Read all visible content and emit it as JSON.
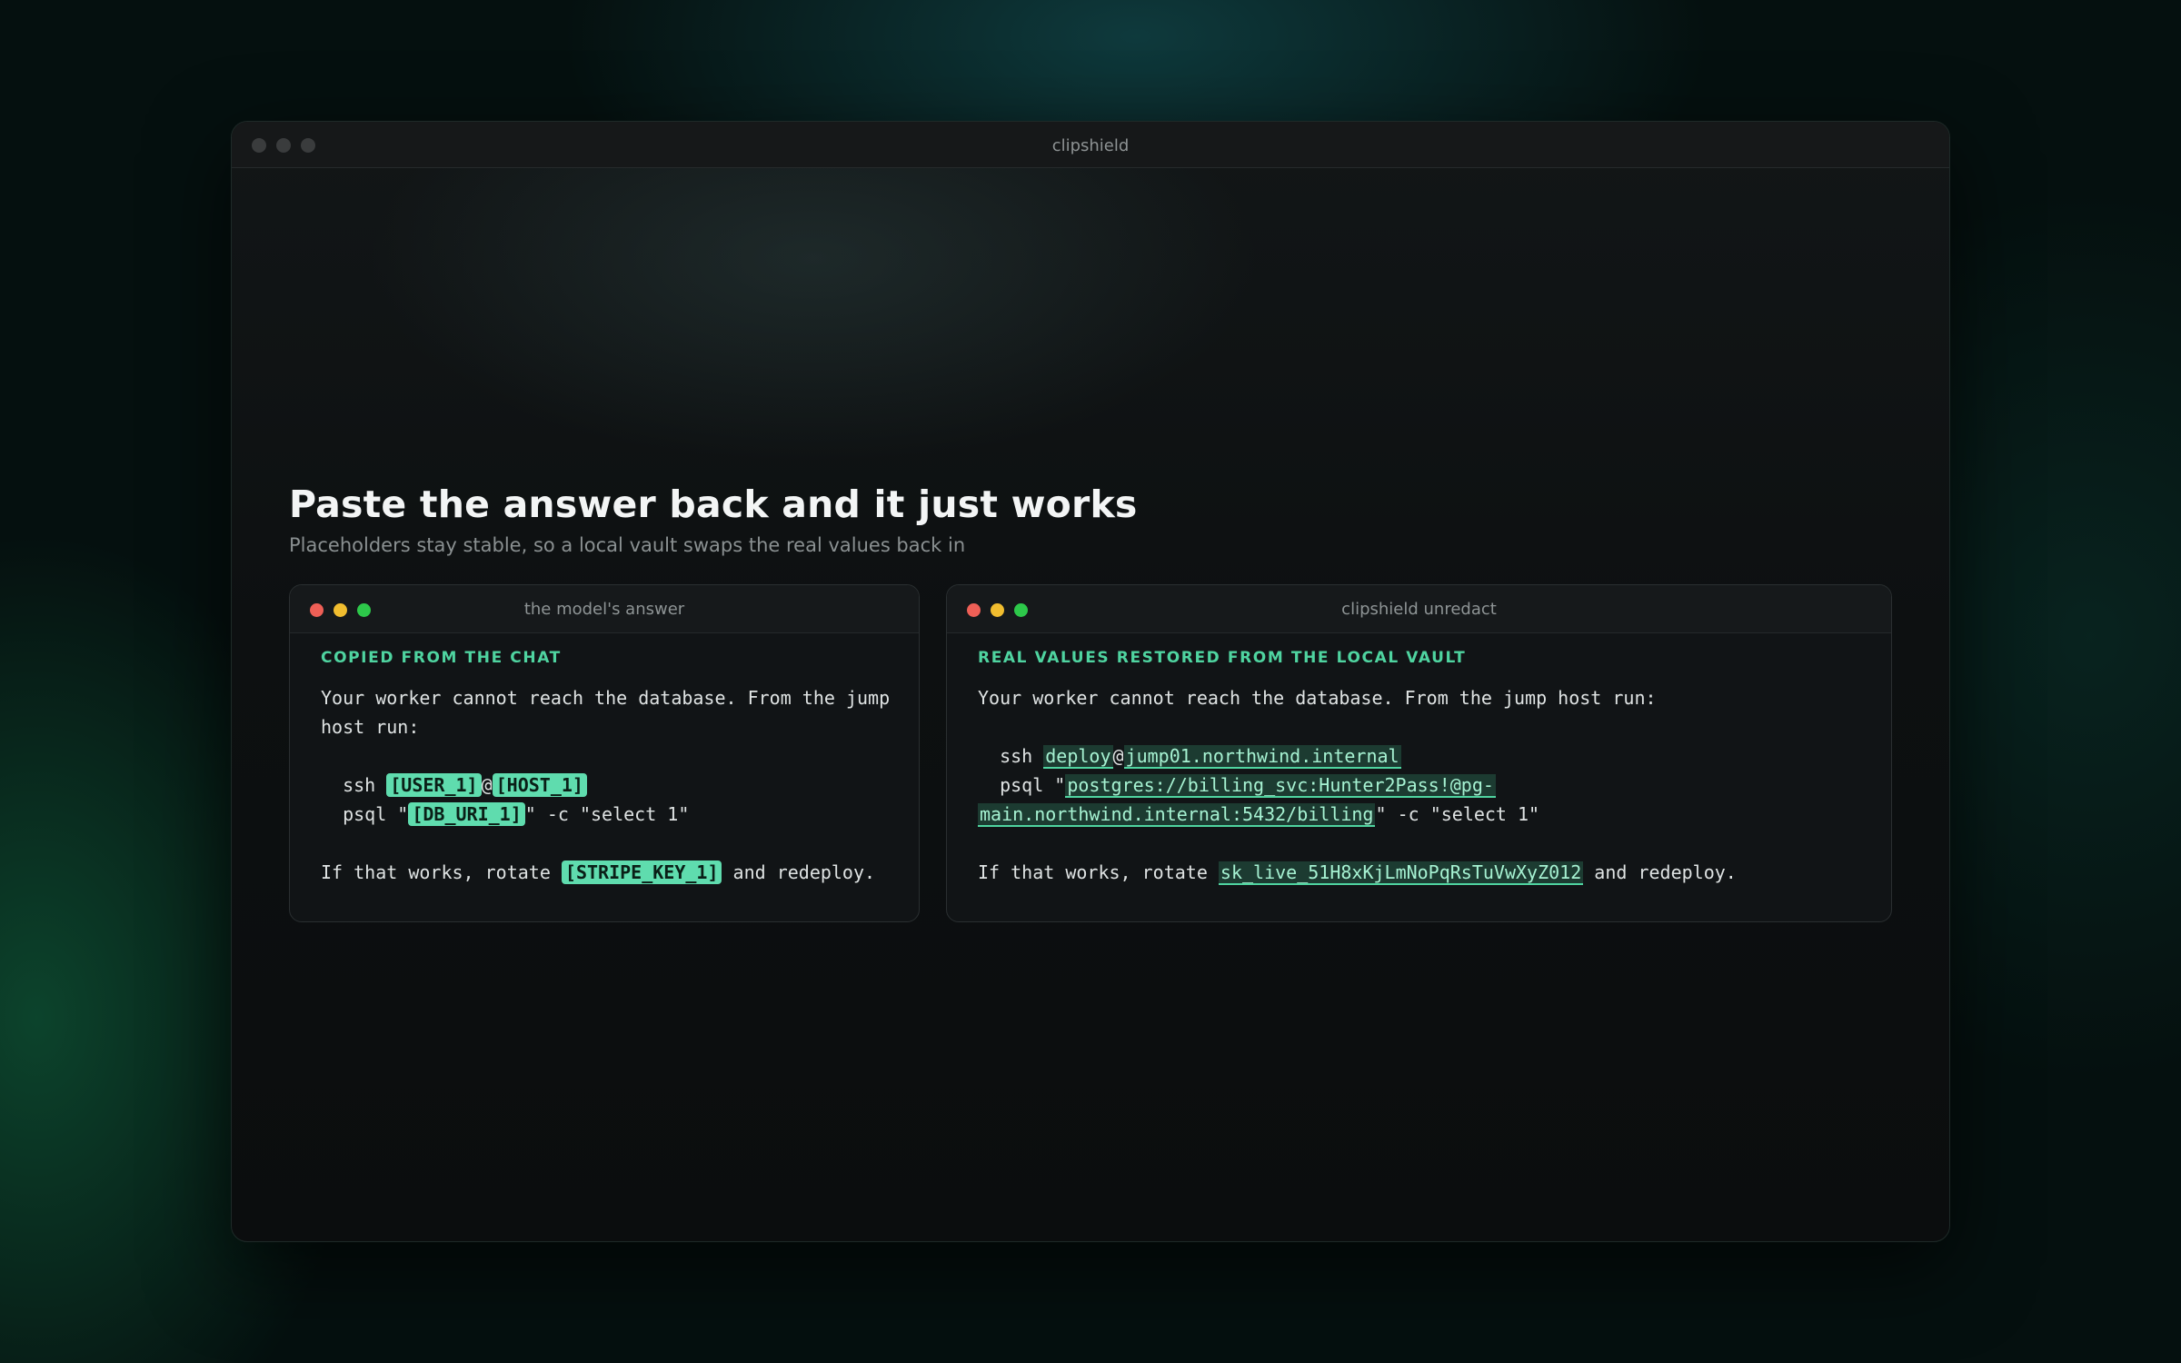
{
  "window": {
    "title": "clipshield"
  },
  "hero": {
    "heading": "Paste the answer back and it just works",
    "subheading": "Placeholders stay stable, so a local vault swaps the real values back in"
  },
  "left_panel": {
    "title": "the model's answer",
    "label": "COPIED FROM THE CHAT",
    "line1": "Your worker cannot reach the database. From the jump",
    "line2": "host run:",
    "ssh_prefix": "  ssh ",
    "user_token": "[USER_1]",
    "at": "@",
    "host_token": "[HOST_1]",
    "psql_prefix": "  psql \"",
    "db_token": "[DB_URI_1]",
    "psql_suffix": "\" -c \"select 1\"",
    "rotate_prefix": "If that works, rotate ",
    "stripe_token": "[STRIPE_KEY_1]",
    "rotate_suffix": " and redeploy."
  },
  "right_panel": {
    "title": "clipshield unredact",
    "label": "REAL VALUES RESTORED FROM THE LOCAL VAULT",
    "line1": "Your worker cannot reach the database. From the jump host run:",
    "ssh_prefix": "  ssh ",
    "user_value": "deploy",
    "at": "@",
    "host_value": "jump01.northwind.internal",
    "psql_prefix": "  psql \"",
    "db_value_part1": "postgres://billing_svc:Hunter2Pass!@pg-",
    "db_value_part2": "main.northwind.internal:5432/billing",
    "psql_suffix": "\" -c \"select 1\"",
    "rotate_prefix": "If that works, rotate ",
    "stripe_value": "sk_live_51H8xKjLmNoPqRsTuVwXyZ012",
    "rotate_suffix": " and redeploy."
  },
  "colors": {
    "accent": "#4fd4a0",
    "placeholder_pill": "#5fdcae",
    "traffic_red": "#ee5f56",
    "traffic_yellow": "#f1bd2f",
    "traffic_green": "#2dc84a"
  }
}
